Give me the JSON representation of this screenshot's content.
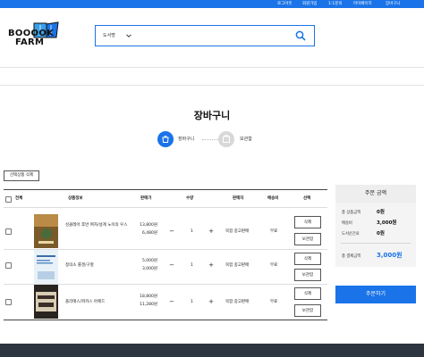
{
  "top_nav": {
    "items": [
      "로그아웃",
      "회원가입",
      "1:1문의",
      "마이페이지",
      "장바구니"
    ]
  },
  "logo": {
    "line1": "BOOOOK",
    "line2": "FARM"
  },
  "search": {
    "category": "도서명",
    "query": ""
  },
  "page_title": "장바구니",
  "steps": [
    {
      "label": "장바구니",
      "active": true,
      "icon": "cart-icon"
    },
    {
      "label": "보관함",
      "active": false,
      "icon": "archive-icon"
    }
  ],
  "delete_selected_label": "선택상품 삭제",
  "table": {
    "headers": [
      "전체",
      "상품정보",
      "판매가",
      "수량",
      "판매자",
      "배송비",
      "선택"
    ],
    "rows": [
      {
        "title": "싱클레어 후반 여자/설계 노이의 우스",
        "price": "13,800원",
        "sale_price": "6,480원",
        "quantity": "1",
        "seller": "북팜 중고판매",
        "shipping": "무료",
        "delete": "삭제",
        "archive": "보관함"
      },
      {
        "title": "정의소 룰겐/구할",
        "price": "5,000원",
        "sale_price": "3,000원",
        "quantity": "1",
        "seller": "북팜 중고판매",
        "shipping": "무료",
        "delete": "삭제",
        "archive": "보관함"
      },
      {
        "title": "플리매스/파카스 아메드",
        "price": "18,800원",
        "sale_price": "11,280원",
        "quantity": "1",
        "seller": "북팜 중고판매",
        "shipping": "무료",
        "delete": "삭제",
        "archive": "보관함"
      }
    ]
  },
  "summary": {
    "title": "주문 금액",
    "rows": [
      {
        "label": "총 상품금액",
        "value": "0원"
      },
      {
        "label": "배송비",
        "value": "3,000원"
      },
      {
        "label": "도서산간료",
        "value": "0원"
      }
    ],
    "total_label": "총 결제금액",
    "total_value": "3,000원",
    "order_button": "주문하기"
  },
  "colors": {
    "accent": "#1a73e8",
    "footer": "#2d3540"
  }
}
